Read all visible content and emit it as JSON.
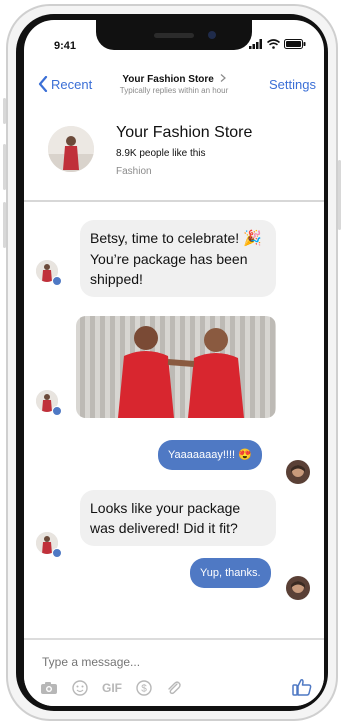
{
  "status_bar": {
    "time": "9:41"
  },
  "header": {
    "back_label": "Recent",
    "title": "Your Fashion Store",
    "subtitle": "Typically replies within an hour",
    "settings_label": "Settings"
  },
  "profile": {
    "name": "Your Fashion Store",
    "likes": "8.9K people like this",
    "category": "Fashion"
  },
  "messages": [
    {
      "from": "store",
      "line1": "Betsy, time to celebrate!",
      "line2": "You’re package has been",
      "line3": "shipped!"
    },
    {
      "from": "store",
      "type": "image",
      "alt": "photo"
    },
    {
      "from": "user",
      "text": "Yaaaaaaay!!!!",
      "emoji": "😍"
    },
    {
      "from": "store",
      "line1": "Looks like your package",
      "line2": "was delivered! Did it fit?"
    },
    {
      "from": "user",
      "text": "Yup, thanks."
    }
  ],
  "composer": {
    "placeholder": "Type a message...",
    "gif_label": "GIF"
  },
  "colors": {
    "accent": "#3b6fd6",
    "bubble_out": "#4f79c4",
    "bubble_in": "#f0f0f0"
  }
}
